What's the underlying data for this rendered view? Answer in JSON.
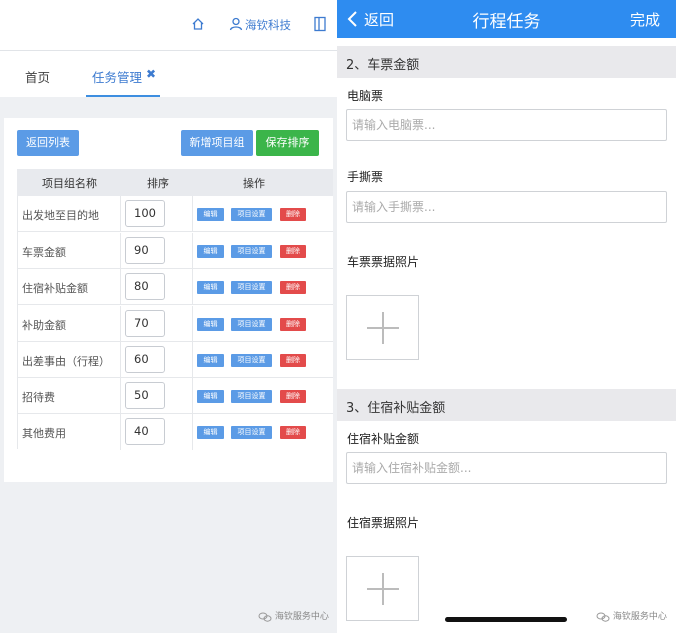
{
  "left": {
    "header": {
      "company": "海钦科技"
    },
    "tabs": {
      "home": "首页",
      "task": "任务管理",
      "close": "✖"
    },
    "buttons": {
      "back": "返回列表",
      "new_group": "新增项目组",
      "save_order": "保存排序"
    },
    "table": {
      "headers": [
        "项目组名称",
        "排序",
        "操作"
      ],
      "rows": [
        {
          "name": "出发地至目的地",
          "order": "100"
        },
        {
          "name": "车票金额",
          "order": "90"
        },
        {
          "name": "住宿补贴金额",
          "order": "80"
        },
        {
          "name": "补助金额",
          "order": "70"
        },
        {
          "name": "出差事由（行程）",
          "order": "60"
        },
        {
          "name": "招待费",
          "order": "50"
        },
        {
          "name": "其他费用",
          "order": "40"
        }
      ],
      "actions": {
        "edit": "编辑",
        "setting": "项目设置",
        "delete": "删除"
      }
    },
    "watermark": "海钦服务中心"
  },
  "right": {
    "navbar": {
      "back": "返回",
      "title": "行程任务",
      "done": "完成"
    },
    "section2": {
      "title": "2、车票金额",
      "field1_label": "电脑票",
      "field1_placeholder": "请输入电脑票...",
      "field2_label": "手撕票",
      "field2_placeholder": "请输入手撕票...",
      "photo_label": "车票票据照片"
    },
    "section3": {
      "title": "3、住宿补贴金额",
      "field1_label": "住宿补贴金额",
      "field1_placeholder": "请输入住宿补贴金额...",
      "photo_label": "住宿票据照片"
    },
    "watermark": "海钦服务中心"
  }
}
